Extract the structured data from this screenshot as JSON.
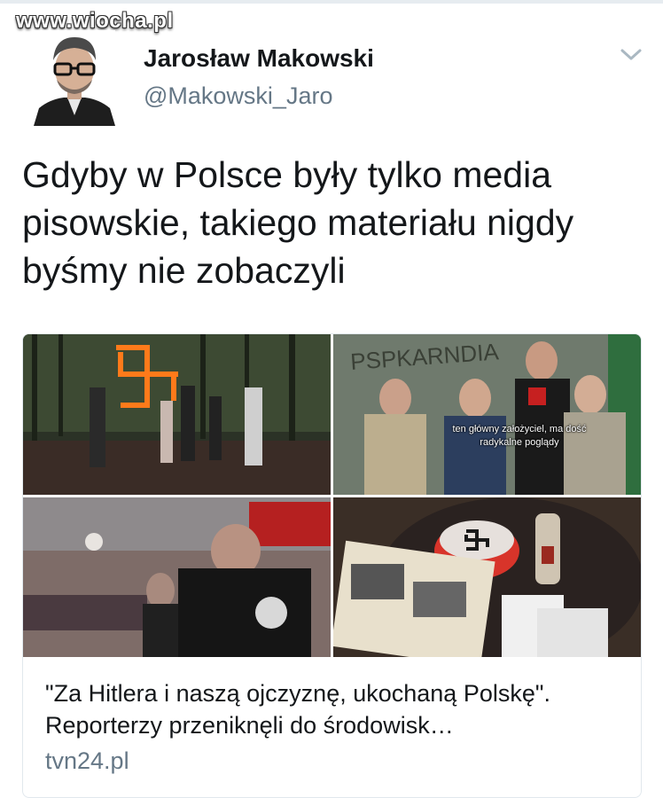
{
  "watermark": "www.wiocha.pl",
  "user": {
    "name": "Jarosław Makowski",
    "handle": "@Makowski_Jaro"
  },
  "icons": {
    "avatar": "profile-photo",
    "menu": "chevron-down-icon"
  },
  "tweet": {
    "text": "Gdyby w Polsce były tylko media pisowskie, takiego materiału nigdy byśmy nie zobaczyli"
  },
  "card": {
    "caption": "ten główny założyciel, ma dość radykalne poglądy",
    "title": "\"Za Hitlera i naszą ojczyznę, ukochaną Polskę\". Reporterzy przeniknęli do środowisk…",
    "domain": "tvn24.pl"
  },
  "colors": {
    "text": "#14171a",
    "secondary": "#657786",
    "border": "#e1e8ed"
  }
}
